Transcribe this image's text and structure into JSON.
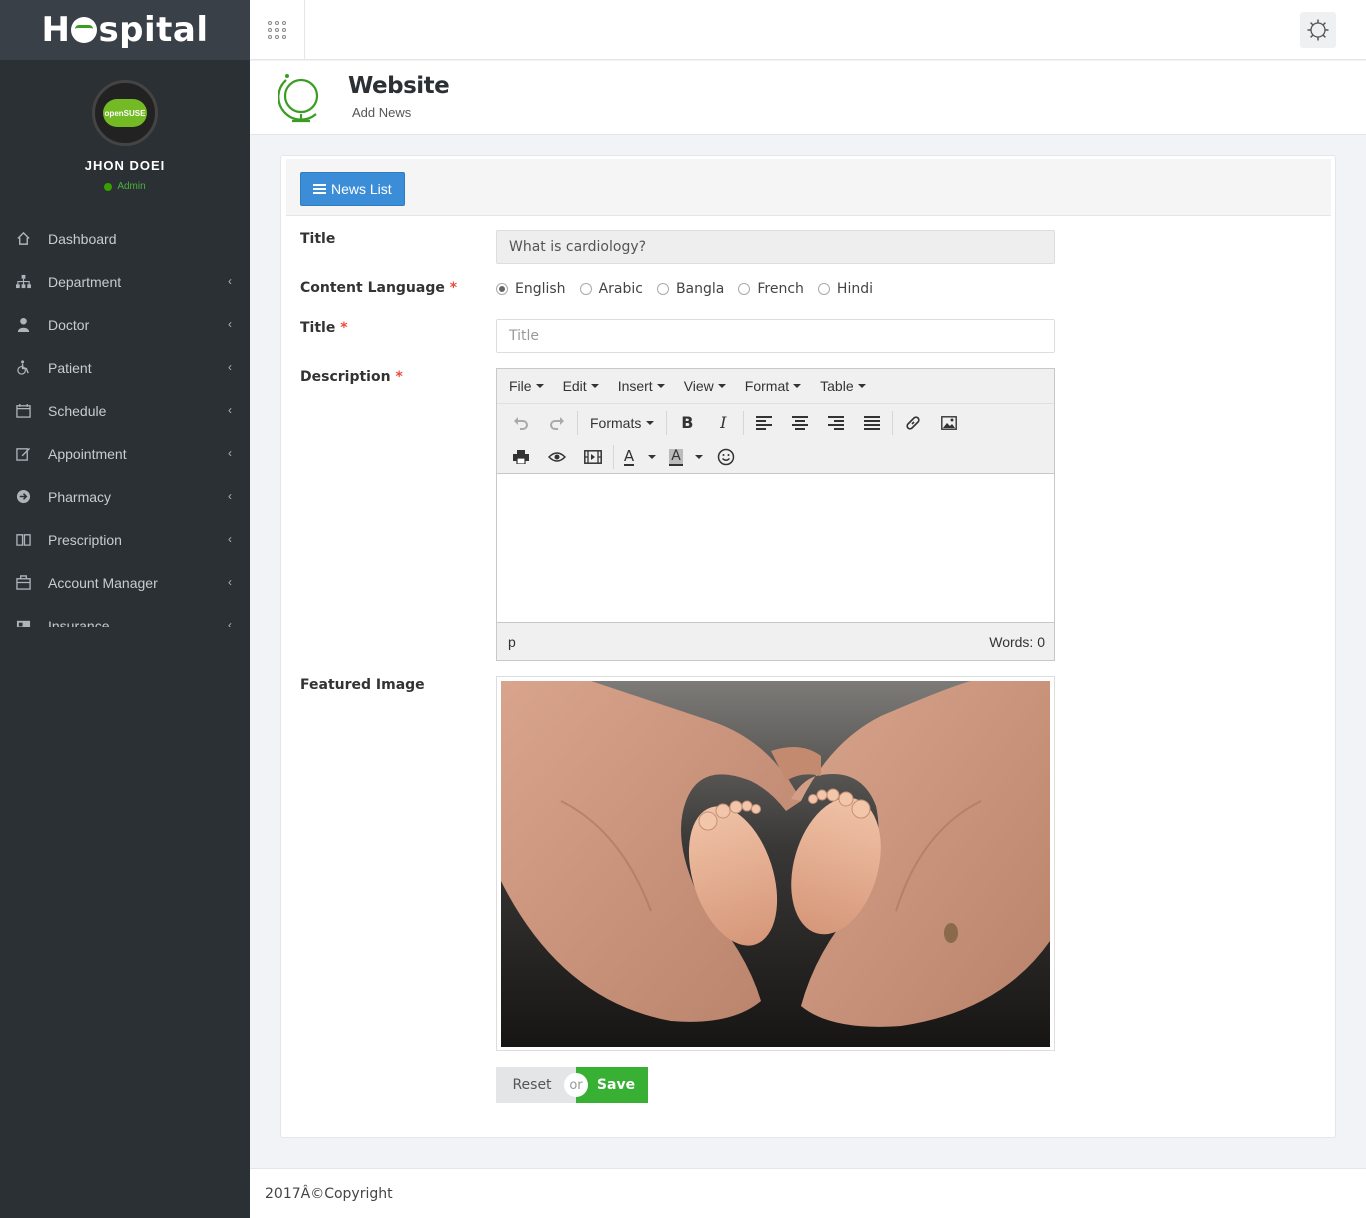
{
  "brand": {
    "prefix": "H",
    "suffix": "spital"
  },
  "user": {
    "name": "JHON DOEI",
    "role": "Admin",
    "avatar_text": "openSUSE"
  },
  "nav": [
    {
      "label": "Dashboard",
      "icon": "home-icon",
      "has_arrow": false
    },
    {
      "label": "Department",
      "icon": "sitemap-icon",
      "has_arrow": true
    },
    {
      "label": "Doctor",
      "icon": "user-md-icon",
      "has_arrow": true
    },
    {
      "label": "Patient",
      "icon": "wheelchair-icon",
      "has_arrow": true
    },
    {
      "label": "Schedule",
      "icon": "calendar-icon",
      "has_arrow": true
    },
    {
      "label": "Appointment",
      "icon": "edit-icon",
      "has_arrow": true
    },
    {
      "label": "Pharmacy",
      "icon": "arrow-circle-icon",
      "has_arrow": true
    },
    {
      "label": "Prescription",
      "icon": "book-icon",
      "has_arrow": true
    },
    {
      "label": "Account Manager",
      "icon": "briefcase-icon",
      "has_arrow": true
    },
    {
      "label": "Insurance",
      "icon": "card-icon",
      "has_arrow": true
    }
  ],
  "page": {
    "title": "Website",
    "subtitle": "Add News"
  },
  "panel": {
    "news_list_button": "News List"
  },
  "form": {
    "title_label": "Title",
    "title_value": "What is cardiology?",
    "content_language_label": "Content Language",
    "languages": [
      "English",
      "Arabic",
      "Bangla",
      "French",
      "Hindi"
    ],
    "selected_language": "English",
    "title2_label": "Title",
    "title2_placeholder": "Title",
    "description_label": "Description",
    "featured_image_label": "Featured Image",
    "required_mark": "*",
    "reset_label": "Reset",
    "or_label": "or",
    "save_label": "Save"
  },
  "editor": {
    "menus": [
      "File",
      "Edit",
      "Insert",
      "View",
      "Format",
      "Table"
    ],
    "formats_label": "Formats",
    "status_path": "p",
    "word_count": "Words: 0"
  },
  "footer": {
    "text": "2017Â©Copyright"
  },
  "colors": {
    "sidebar": "#2b3035",
    "primary": "#3c8dd7",
    "success": "#37b034",
    "accent": "#4ab13a"
  }
}
